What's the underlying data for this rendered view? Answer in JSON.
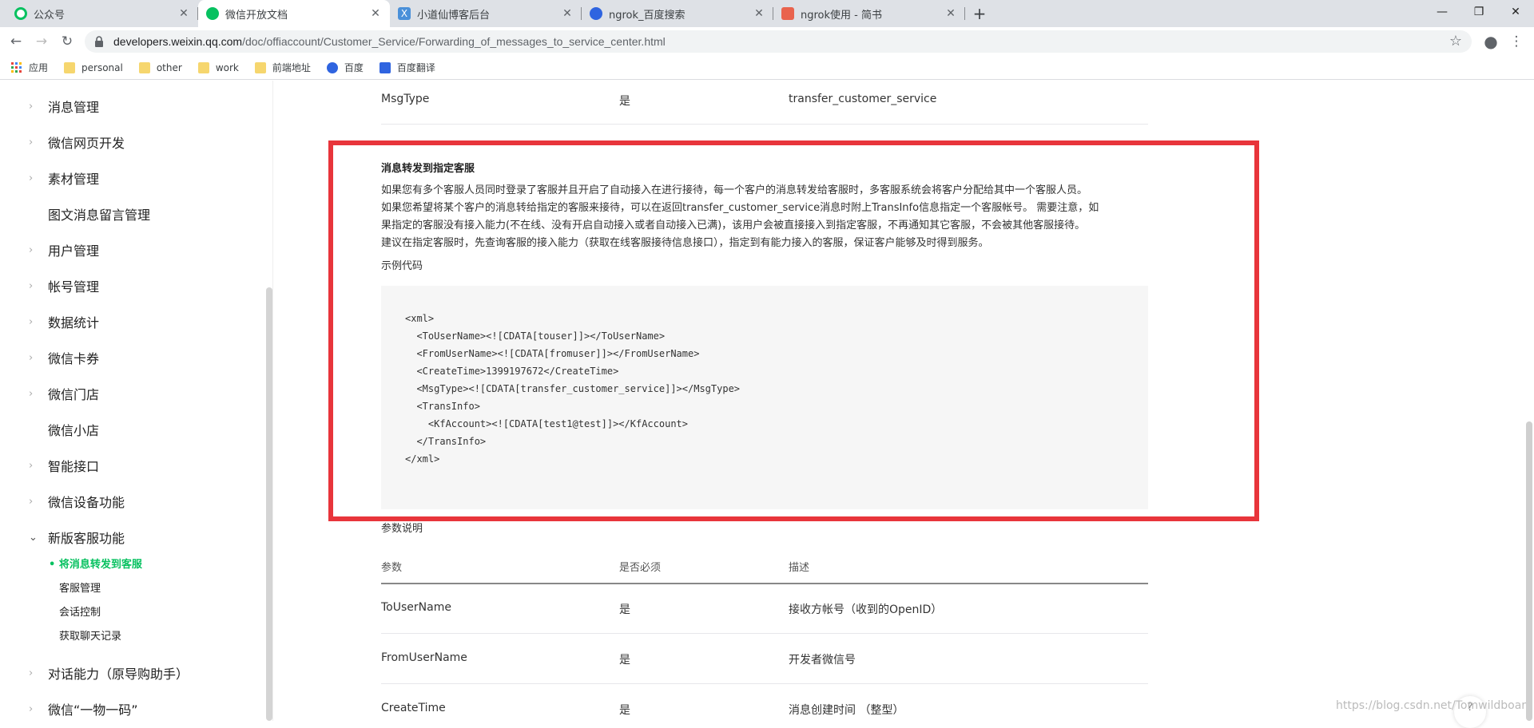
{
  "browser": {
    "tabs": [
      {
        "label": "公众号",
        "icon": "wechat-official-icon"
      },
      {
        "label": "微信开放文档",
        "icon": "wechat-icon",
        "active": true
      },
      {
        "label": "小道仙博客后台",
        "icon": "x-icon"
      },
      {
        "label": "ngrok_百度搜索",
        "icon": "baidu-icon"
      },
      {
        "label": "ngrok使用 - 简书",
        "icon": "jianshu-icon"
      }
    ],
    "url_host": "developers.weixin.qq.com",
    "url_path": "/doc/offiaccount/Customer_Service/Forwarding_of_messages_to_service_center.html",
    "bookmarks": [
      {
        "label": "应用",
        "icon": "apps-grid-icon"
      },
      {
        "label": "personal",
        "icon": "folder-icon"
      },
      {
        "label": "other",
        "icon": "folder-icon"
      },
      {
        "label": "work",
        "icon": "folder-icon"
      },
      {
        "label": "前端地址",
        "icon": "folder-icon"
      },
      {
        "label": "百度",
        "icon": "baidu-icon"
      },
      {
        "label": "百度翻译",
        "icon": "translate-icon"
      }
    ]
  },
  "sidebar": {
    "items": [
      {
        "label": "消息管理",
        "expandable": true
      },
      {
        "label": "微信网页开发",
        "expandable": true
      },
      {
        "label": "素材管理",
        "expandable": true
      },
      {
        "label": "图文消息留言管理",
        "expandable": false
      },
      {
        "label": "用户管理",
        "expandable": true
      },
      {
        "label": "帐号管理",
        "expandable": true
      },
      {
        "label": "数据统计",
        "expandable": true
      },
      {
        "label": "微信卡券",
        "expandable": true
      },
      {
        "label": "微信门店",
        "expandable": true
      },
      {
        "label": "微信小店",
        "expandable": false
      },
      {
        "label": "智能接口",
        "expandable": true
      },
      {
        "label": "微信设备功能",
        "expandable": true
      },
      {
        "label": "新版客服功能",
        "expandable": true,
        "open": true
      },
      {
        "label": "对话能力（原导购助手）",
        "expandable": true
      },
      {
        "label": "微信“一物一码”",
        "expandable": true
      }
    ],
    "subitems": [
      {
        "label": "将消息转发到客服",
        "current": true
      },
      {
        "label": "客服管理"
      },
      {
        "label": "会话控制"
      },
      {
        "label": "获取聊天记录"
      }
    ]
  },
  "content": {
    "top_row": {
      "param": "MsgType",
      "required": "是",
      "desc": "transfer_customer_service"
    },
    "section_title": "消息转发到指定客服",
    "paragraphs": [
      "如果您有多个客服人员同时登录了客服并且开启了自动接入在进行接待，每一个客户的消息转发给客服时，多客服系统会将客户分配给其中一个客服人员。",
      "如果您希望将某个客户的消息转给指定的客服来接待，可以在返回transfer_customer_service消息时附上TransInfo信息指定一个客服帐号。 需要注意，如",
      "果指定的客服没有接入能力(不在线、没有开启自动接入或者自动接入已满)，该用户会被直接接入到指定客服，不再通知其它客服，不会被其他客服接待。",
      "建议在指定客服时，先查询客服的接入能力（获取在线客服接待信息接口），指定到有能力接入的客服，保证客户能够及时得到服务。"
    ],
    "code_label": "示例代码",
    "code_lines": [
      "<xml>",
      "  <ToUserName><![CDATA[touser]]></ToUserName>",
      "  <FromUserName><![CDATA[fromuser]]></FromUserName>",
      "  <CreateTime>1399197672</CreateTime>",
      "  <MsgType><![CDATA[transfer_customer_service]]></MsgType>",
      "  <TransInfo>",
      "    <KfAccount><![CDATA[test1@test]]></KfAccount>",
      "  </TransInfo>",
      "</xml>"
    ],
    "param_label": "参数说明",
    "table_headers": [
      "参数",
      "是否必须",
      "描述"
    ],
    "table_rows": [
      {
        "param": "ToUserName",
        "required": "是",
        "desc": "接收方帐号（收到的OpenID）"
      },
      {
        "param": "FromUserName",
        "required": "是",
        "desc": "开发者微信号"
      },
      {
        "param": "CreateTime",
        "required": "是",
        "desc": "消息创建时间 （整型）"
      }
    ]
  },
  "watermark": "https://blog.csdn.net/Tomwildboar",
  "feedback_icon": "?"
}
